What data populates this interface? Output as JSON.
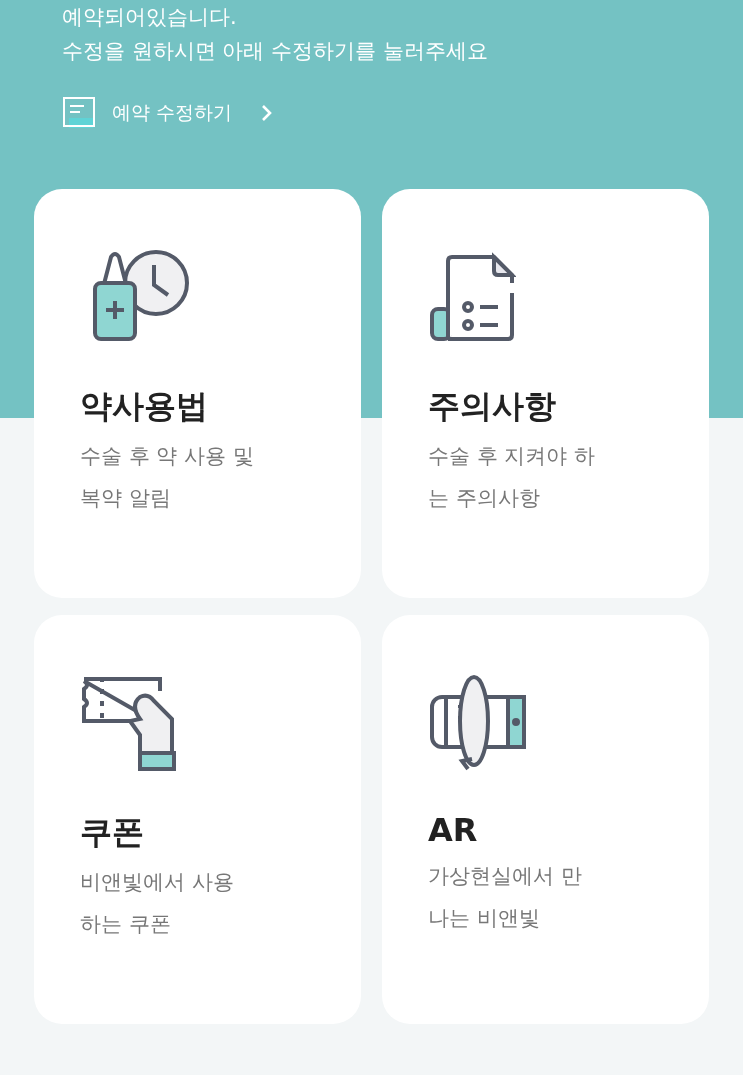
{
  "header": {
    "message_lines": [
      "예약되어있습니다.",
      "수정을 원하시면 아래 수정하기를 눌러주세요"
    ],
    "edit_link": "예약 수정하기"
  },
  "cards": [
    {
      "kind": "medicine",
      "title": "약사용법",
      "description_lines": [
        "수술 후 약 사용 및",
        "복약 알림"
      ]
    },
    {
      "kind": "notice",
      "title": "주의사항",
      "description_lines": [
        "수술 후 지켜야 하",
        "는 주의사항"
      ]
    },
    {
      "kind": "coupon",
      "title": "쿠폰",
      "description_lines": [
        "비앤빛에서 사용",
        "하는 쿠폰"
      ]
    },
    {
      "kind": "ar",
      "title": "AR",
      "description_lines": [
        "가상현실에서 만",
        "나는 비앤빛"
      ]
    }
  ]
}
